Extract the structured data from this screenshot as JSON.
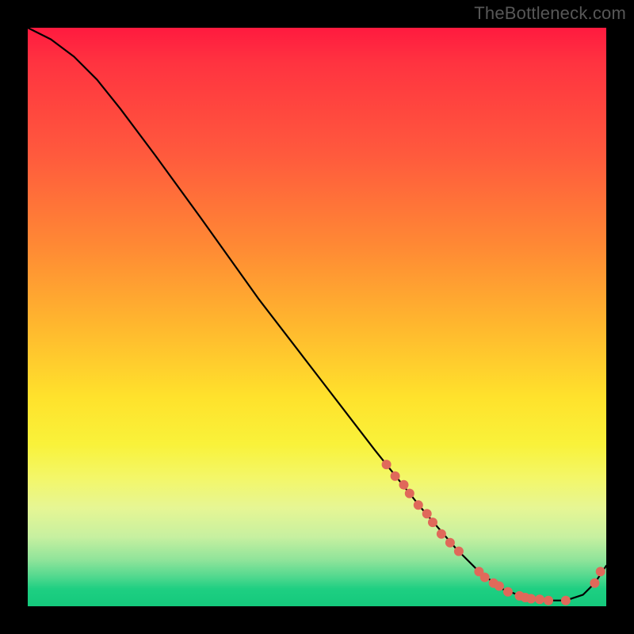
{
  "watermark": "TheBottleneck.com",
  "chart_data": {
    "type": "line",
    "title": "",
    "xlabel": "",
    "ylabel": "",
    "xlim": [
      0,
      100
    ],
    "ylim": [
      0,
      100
    ],
    "grid": false,
    "series": [
      {
        "name": "curve",
        "x": [
          0,
          4,
          8,
          12,
          16,
          22,
          30,
          40,
          50,
          60,
          68,
          74,
          78,
          82,
          86,
          90,
          93,
          96,
          98,
          100
        ],
        "y": [
          100,
          98,
          95,
          91,
          86,
          78,
          67,
          53,
          40,
          27,
          17,
          10,
          6,
          3,
          1.5,
          1,
          1,
          2,
          4,
          7
        ]
      }
    ],
    "scatter": {
      "name": "dots",
      "color": "#e0695a",
      "x": [
        62,
        63.5,
        65,
        66,
        67.5,
        69,
        70,
        71.5,
        73,
        74.5,
        78,
        79,
        80.5,
        81.5,
        83,
        85,
        86,
        87,
        88.5,
        90,
        93,
        98,
        99
      ],
      "y": [
        24.5,
        22.5,
        21,
        19.5,
        17.5,
        16,
        14.5,
        12.5,
        11,
        9.5,
        6,
        5,
        4,
        3.5,
        2.5,
        1.8,
        1.5,
        1.3,
        1.2,
        1,
        1,
        4,
        6
      ]
    }
  }
}
